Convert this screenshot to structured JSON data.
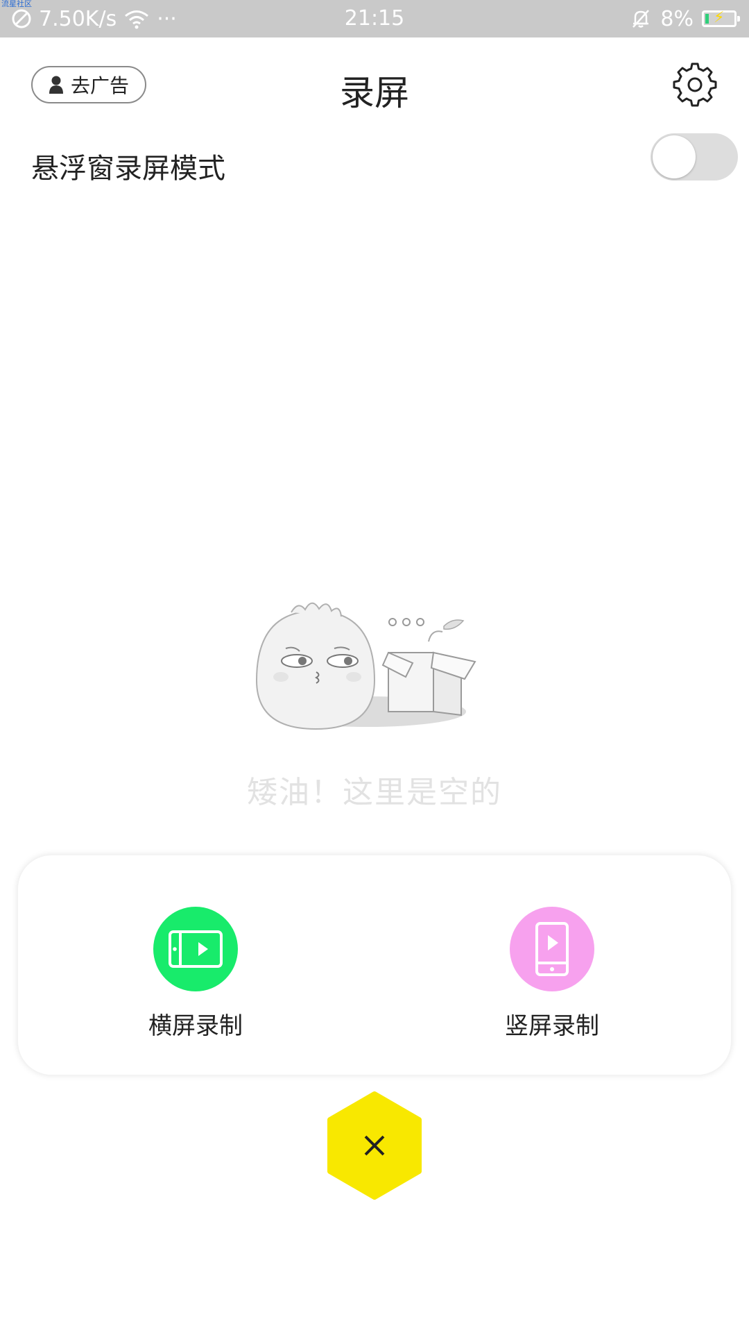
{
  "status_bar": {
    "corner_mark": "流星社区",
    "speed": "7.50K/s",
    "more": "···",
    "time": "21:15",
    "battery": "8%"
  },
  "header": {
    "ad_button_label": "去广告",
    "title": "录屏"
  },
  "float_mode": {
    "label": "悬浮窗录屏模式",
    "enabled": false
  },
  "empty_state": {
    "message": "矮油！这里是空的"
  },
  "record_options": {
    "landscape_label": "横屏录制",
    "portrait_label": "竖屏录制"
  },
  "colors": {
    "landscape": "#18eb6b",
    "portrait": "#f7a1ee",
    "close": "#f8e800"
  },
  "icons": {
    "settings": "gear-icon",
    "user": "person-icon",
    "close": "close-icon"
  }
}
